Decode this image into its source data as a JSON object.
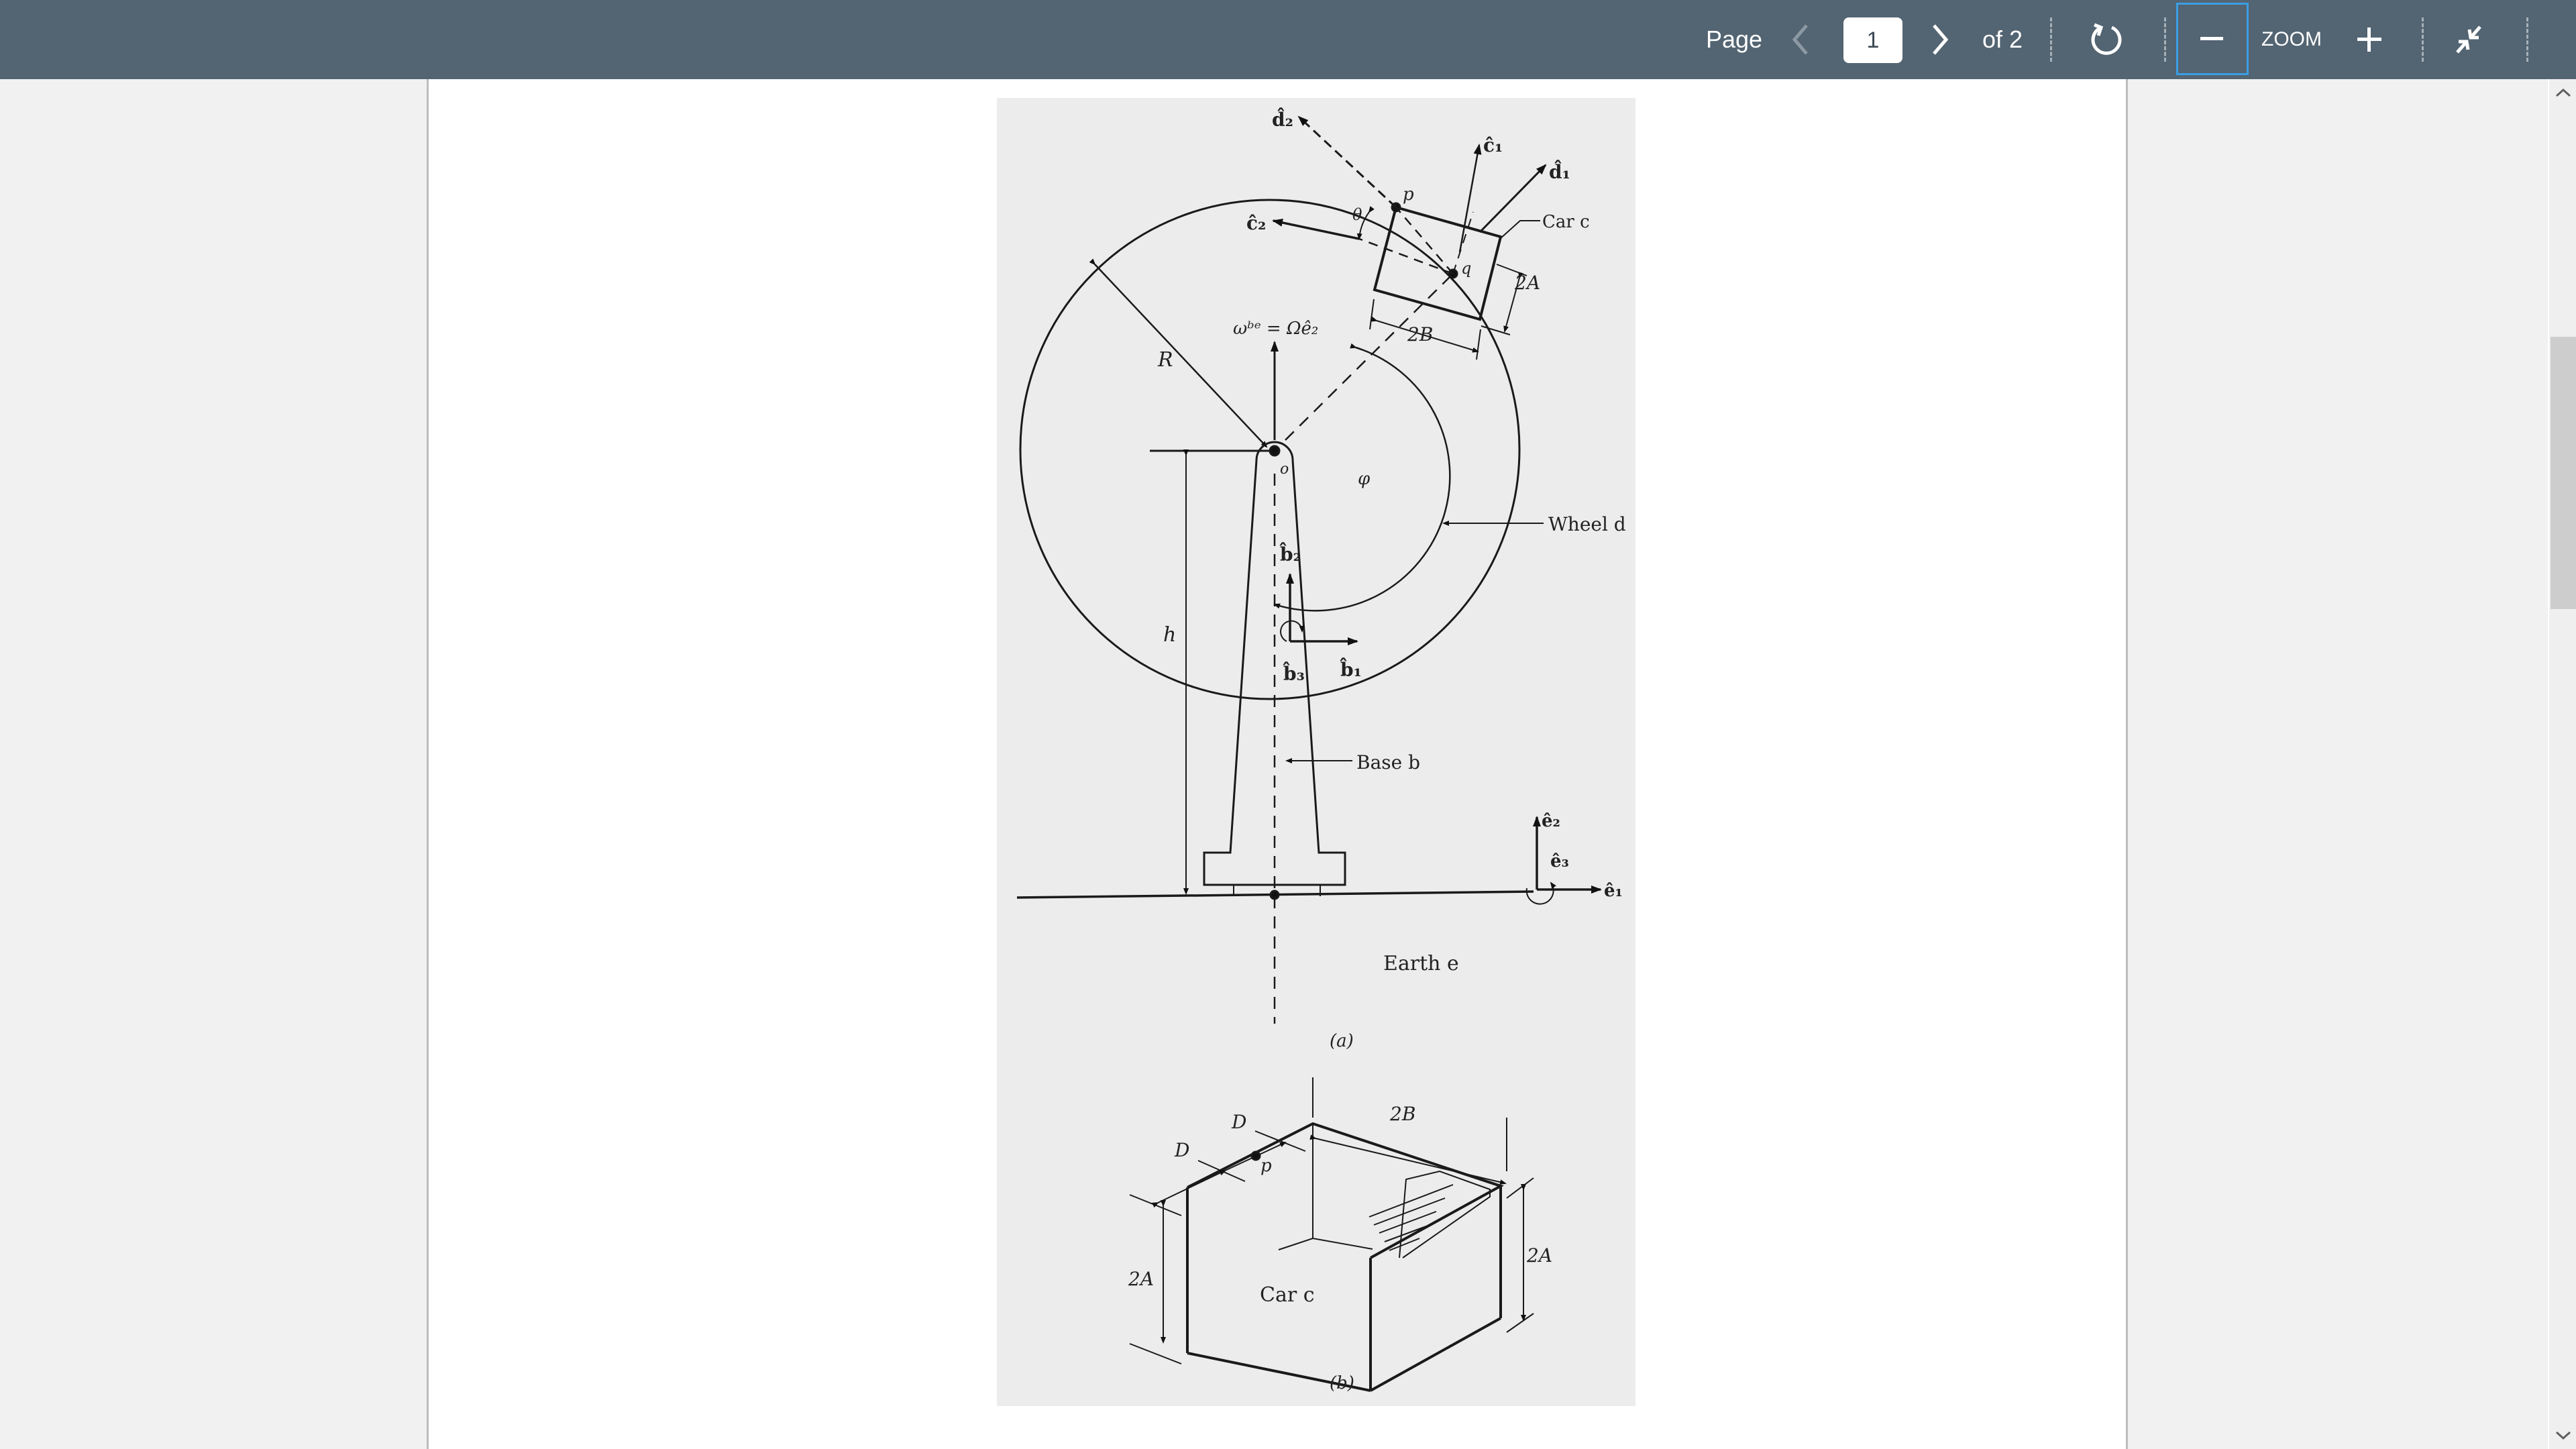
{
  "toolbar": {
    "page_label": "Page",
    "current_page": "1",
    "of_label": "of 2",
    "zoom_label": "ZOOM",
    "icons": {
      "prev": "chevron-left-icon",
      "next": "chevron-right-icon",
      "rotate": "rotate-clockwise-icon",
      "zoom_out": "minus-icon",
      "zoom_in": "plus-icon",
      "fit": "collapse-arrows-icon"
    },
    "colors": {
      "bar": "#536472",
      "focus": "#3b9ee3"
    }
  },
  "figure": {
    "a": {
      "labels": {
        "d2": "d̂₂",
        "c1": "ĉ₁",
        "d1": "d̂₁",
        "p": "p",
        "theta": "θ",
        "c2": "ĉ₂",
        "car": "Car c",
        "q": "q",
        "dim_2A": "2A",
        "dim_2B": "2B",
        "omega": "ωᵇᵉ = Ωê₂",
        "R": "R",
        "o": "o",
        "phi": "φ",
        "wheel": "Wheel d",
        "b2": "b̂₂",
        "b3": "b̂₃",
        "b1": "b̂₁",
        "h": "h",
        "base": "Base b",
        "e2": "ê₂",
        "e3": "ê₃",
        "e1": "ê₁",
        "earth": "Earth e",
        "caption": "(a)"
      }
    },
    "b": {
      "labels": {
        "D_top": "D",
        "D_bottom": "D",
        "p": "p",
        "dim_2B": "2B",
        "dim_2A_left": "2A",
        "dim_2A_right": "2A",
        "car": "Car c",
        "caption": "(b)"
      }
    }
  },
  "scrollbar": {
    "up": "chevron-up-icon",
    "down": "chevron-down-icon"
  }
}
